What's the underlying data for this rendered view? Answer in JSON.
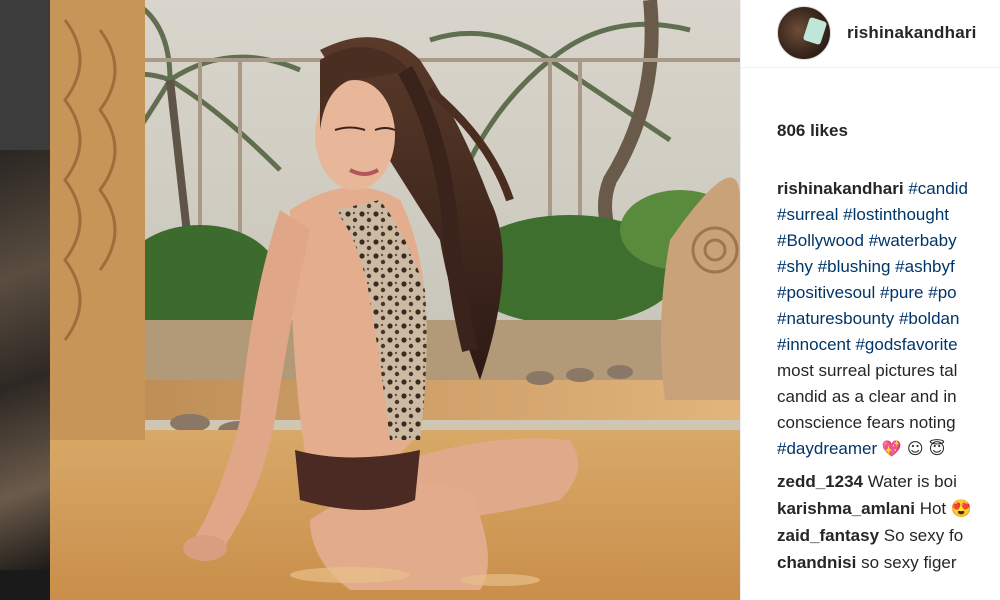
{
  "post": {
    "username": "rishinakandhari",
    "likes": "806 likes",
    "caption": {
      "username": "rishinakandhari",
      "lines": [
        [
          "#candid"
        ],
        [
          "#surreal",
          "#lostinthought"
        ],
        [
          "#Bollywood",
          "#waterbaby"
        ],
        [
          "#shy",
          "#blushing",
          "#ashbyf"
        ],
        [
          "#positivesoul",
          "#pure",
          "#po"
        ],
        [
          "#naturesbounty",
          "#boldan"
        ],
        [
          "#innocent",
          "#godsfavorite"
        ]
      ],
      "text_lines": [
        "most surreal pictures tal",
        "candid as a clear and in",
        "conscience fears noting"
      ],
      "last_tag": "#daydreamer",
      "last_emojis": "💖 ☺ 😇"
    },
    "comments": [
      {
        "user": "zedd_1234",
        "text": "Water is boi"
      },
      {
        "user": "karishma_amlani",
        "text": "Hot 😍"
      },
      {
        "user": "zaid_fantasy",
        "text": "So sexy fo"
      },
      {
        "user": "chandnisi",
        "text": "so sexy figer"
      }
    ]
  },
  "colors": {
    "hashtag": "#003569",
    "text": "#262626",
    "divider": "#efefef"
  },
  "icons": [
    "avatar-image"
  ]
}
